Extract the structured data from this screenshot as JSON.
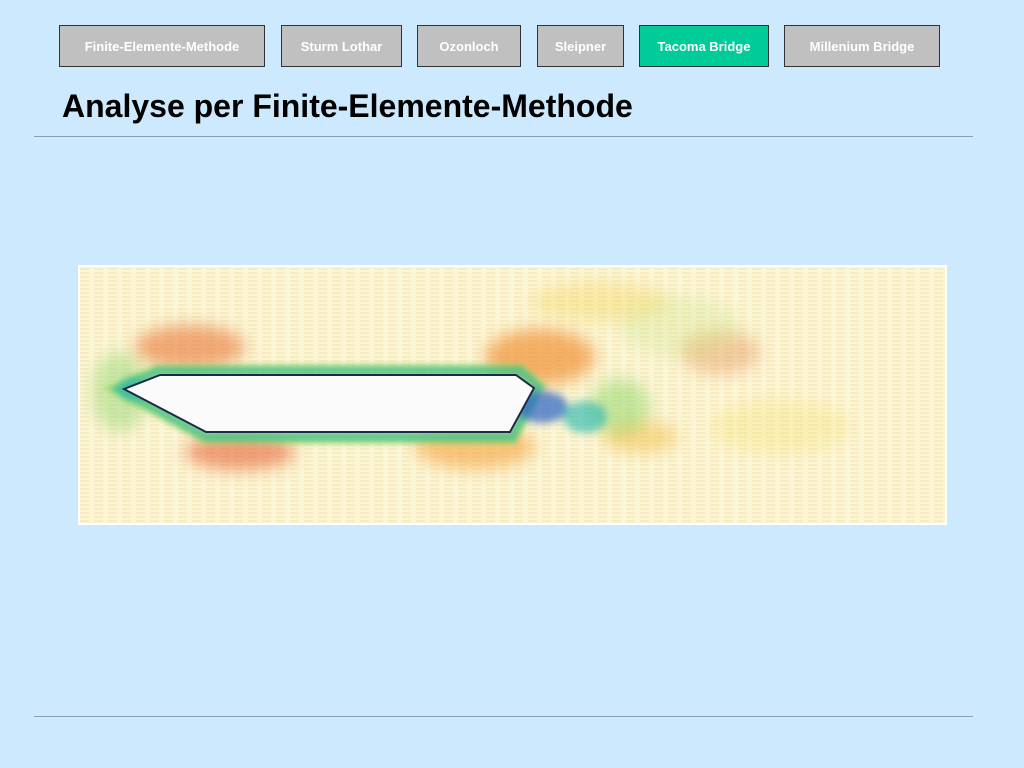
{
  "nav": {
    "items": [
      {
        "label": "Finite-Elemente-Methode",
        "active": false
      },
      {
        "label": "Sturm Lothar",
        "active": false
      },
      {
        "label": "Ozonloch",
        "active": false
      },
      {
        "label": "Sleipner",
        "active": false
      },
      {
        "label": "Tacoma Bridge",
        "active": true
      },
      {
        "label": "Millenium Bridge",
        "active": false
      }
    ],
    "colors": {
      "inactive": "#c0c0c0",
      "active": "#00cc99",
      "text": "#ffffff"
    }
  },
  "page": {
    "title": "Analyse per Finite-Elemente-Methode",
    "background": "#cce9fd"
  },
  "figure": {
    "icon": "flow-simulation-image",
    "colors": [
      "#e05a1e",
      "#f5a623",
      "#f2e14c",
      "#7fd35a",
      "#1fb6b0",
      "#2a62c8"
    ]
  }
}
